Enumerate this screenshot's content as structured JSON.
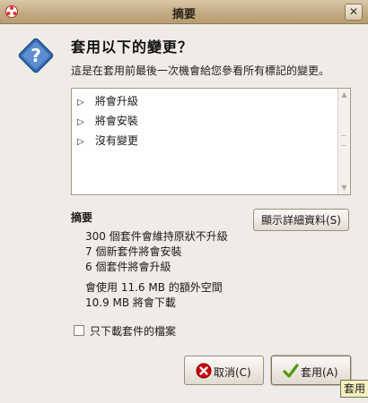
{
  "window": {
    "title": "摘要",
    "close_glyph": "✕"
  },
  "dialog": {
    "heading": "套用以下的變更？",
    "subtitle": "這是在套用前最後一次機會給您參看所有標記的變更。",
    "icon": "question-icon"
  },
  "changes_tree": {
    "items": [
      {
        "label": "將會升級",
        "expander": "▷"
      },
      {
        "label": "將會安裝",
        "expander": "▷"
      },
      {
        "label": "沒有變更",
        "expander": "▷"
      }
    ]
  },
  "summary": {
    "label": "摘要",
    "details_button": "顯示詳細資料(S)",
    "lines": [
      "300 個套件會維持原狀不升級",
      "7 個新套件將會安裝",
      "6 個套件將會升級"
    ],
    "space_lines": [
      "會使用 11.6 MB 的額外空間",
      "10.9 MB 將會下載"
    ]
  },
  "options": {
    "download_only_label": "只下載套件的檔案",
    "download_only_checked": false
  },
  "buttons": {
    "cancel_label": "取消(C)",
    "apply_label": "套用(A)"
  },
  "tooltip": {
    "text": "套用"
  },
  "colors": {
    "titlebar": "#c3ab82",
    "window_bg": "#efebe7",
    "icon_blue": "#3465a4",
    "cancel_red": "#cc0000",
    "apply_green": "#4e9a06"
  }
}
